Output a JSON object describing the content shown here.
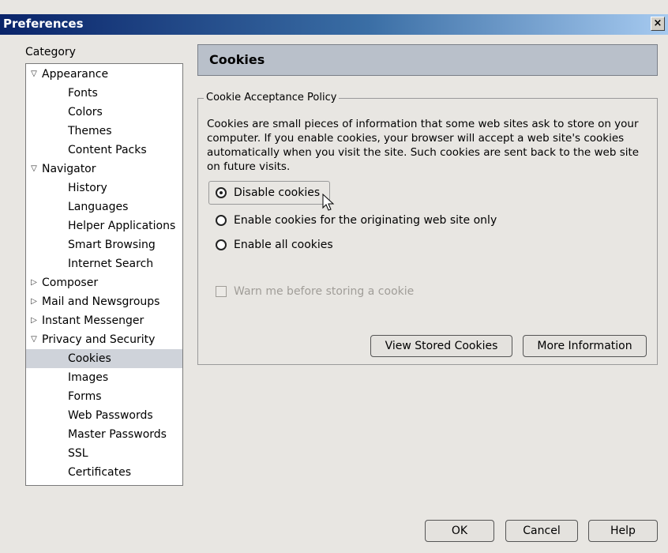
{
  "window": {
    "title": "Preferences",
    "close_glyph": "×"
  },
  "category": {
    "label": "Category",
    "tree": [
      {
        "label": "Appearance",
        "level": 0,
        "twisty": "▽"
      },
      {
        "label": "Fonts",
        "level": 1
      },
      {
        "label": "Colors",
        "level": 1
      },
      {
        "label": "Themes",
        "level": 1
      },
      {
        "label": "Content Packs",
        "level": 1
      },
      {
        "label": "Navigator",
        "level": 0,
        "twisty": "▽"
      },
      {
        "label": "History",
        "level": 1
      },
      {
        "label": "Languages",
        "level": 1
      },
      {
        "label": "Helper Applications",
        "level": 1
      },
      {
        "label": "Smart Browsing",
        "level": 1
      },
      {
        "label": "Internet Search",
        "level": 1
      },
      {
        "label": "Composer",
        "level": 0,
        "twisty": "▷"
      },
      {
        "label": "Mail and Newsgroups",
        "level": 0,
        "twisty": "▷"
      },
      {
        "label": "Instant Messenger",
        "level": 0,
        "twisty": "▷"
      },
      {
        "label": "Privacy and Security",
        "level": 0,
        "twisty": "▽"
      },
      {
        "label": "Cookies",
        "level": 1,
        "selected": true
      },
      {
        "label": "Images",
        "level": 1
      },
      {
        "label": "Forms",
        "level": 1
      },
      {
        "label": "Web Passwords",
        "level": 1
      },
      {
        "label": "Master Passwords",
        "level": 1
      },
      {
        "label": "SSL",
        "level": 1
      },
      {
        "label": "Certificates",
        "level": 1
      }
    ]
  },
  "panel": {
    "header": "Cookies",
    "group_title": "Cookie Acceptance Policy",
    "description": "Cookies are small pieces of information that some web sites ask to store on your computer. If you enable cookies, your browser will accept a web site's cookies automatically when you visit the site. Such cookies are sent back to the web site on future visits.",
    "radios": [
      {
        "label": "Disable cookies",
        "selected": true
      },
      {
        "label": "Enable cookies for the originating web site only",
        "selected": false
      },
      {
        "label": "Enable all cookies",
        "selected": false
      }
    ],
    "warn_checkbox": {
      "label": "Warn me before storing a cookie",
      "checked": false,
      "disabled": true
    },
    "view_stored_label": "View Stored Cookies",
    "more_info_label": "More Information"
  },
  "footer": {
    "ok_label": "OK",
    "cancel_label": "Cancel",
    "help_label": "Help"
  },
  "colors": {
    "title_bar": "#0a246a",
    "panel_header": "#b9c0ca",
    "selection": "#cfd3da",
    "window_bg": "#e8e6e2"
  }
}
